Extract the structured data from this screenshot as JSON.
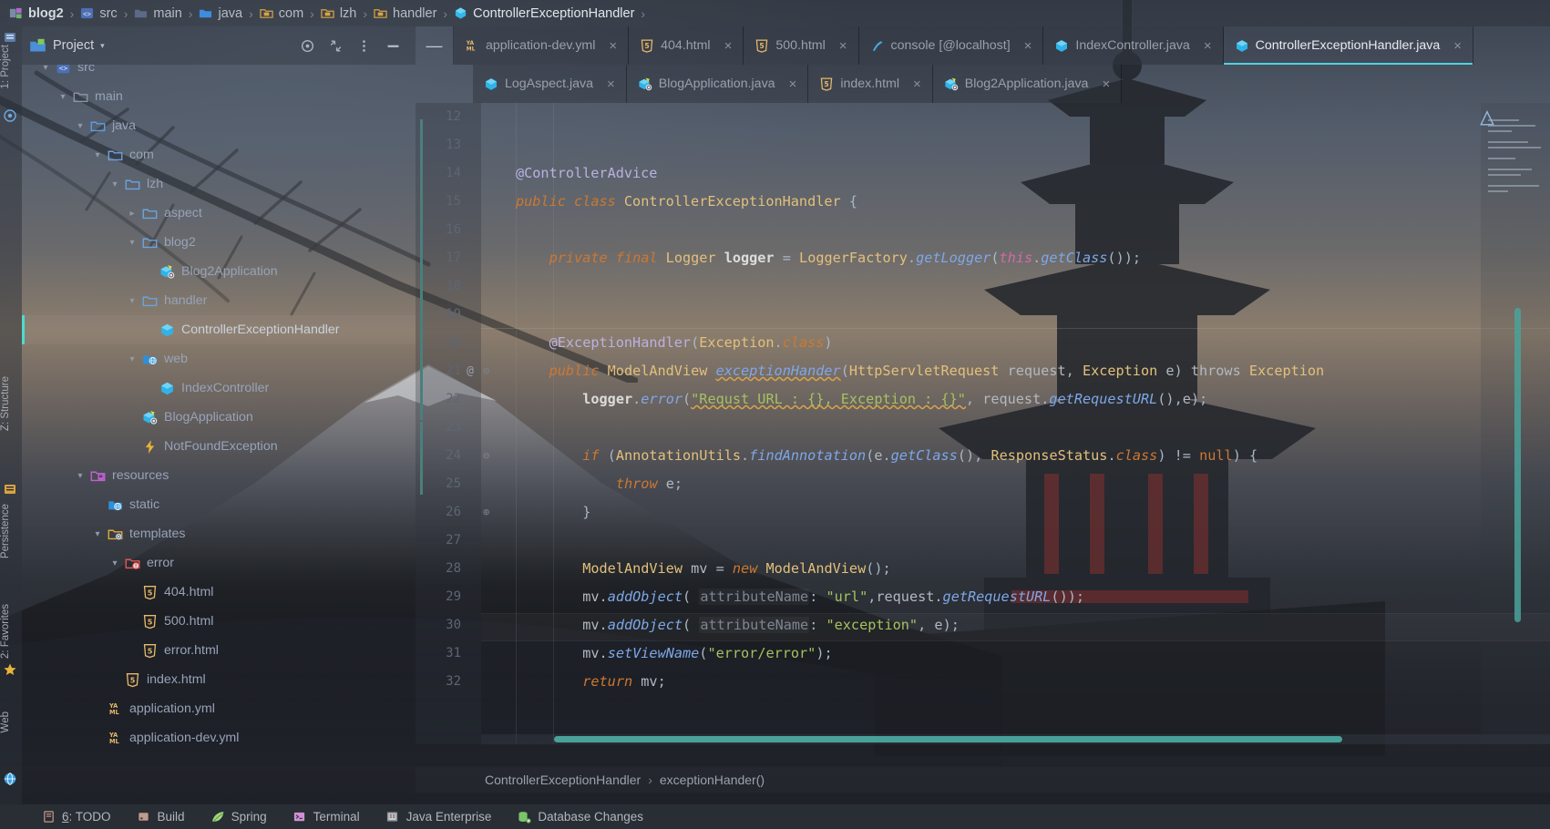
{
  "window": {
    "title": "ControllerExceptionHandler.java",
    "accent_color": "#4fd2e0",
    "background": "#2b2f36"
  },
  "breadcrumb": {
    "items": [
      {
        "label": "blog2",
        "icon": "module-icon"
      },
      {
        "label": "src",
        "icon": "source-root-icon"
      },
      {
        "label": "main",
        "icon": "folder-icon"
      },
      {
        "label": "java",
        "icon": "folder-blue-icon"
      },
      {
        "label": "com",
        "icon": "package-icon"
      },
      {
        "label": "lzh",
        "icon": "package-icon"
      },
      {
        "label": "handler",
        "icon": "package-icon"
      },
      {
        "label": "ControllerExceptionHandler",
        "icon": "java-class-icon"
      }
    ],
    "separator": "›"
  },
  "left_strip": {
    "tabs": [
      {
        "label": "1: Project",
        "icon": "project-icon"
      },
      {
        "label": "Z: Structure",
        "icon": "structure-icon"
      },
      {
        "label": "Persistence",
        "icon": "persistence-icon"
      },
      {
        "label": "2: Favorites",
        "icon": "star-icon"
      },
      {
        "label": "Web",
        "icon": "web-icon"
      }
    ]
  },
  "project_panel": {
    "title": "Project",
    "dropdown_caret": "▾",
    "actions": [
      {
        "name": "locate-icon",
        "glyph": "◎"
      },
      {
        "name": "collapse-all-icon",
        "glyph": "⇲"
      },
      {
        "name": "more-options-icon",
        "glyph": "⋮"
      },
      {
        "name": "hide-panel-icon",
        "glyph": "—"
      }
    ],
    "tree": [
      {
        "label": "src",
        "indent": 2,
        "arrow": "▾",
        "icon": "source-root-icon",
        "selected": false,
        "clipped": true
      },
      {
        "label": "main",
        "indent": 3,
        "arrow": "▾",
        "icon": "folder-grey-icon",
        "selected": false
      },
      {
        "label": "java",
        "indent": 4,
        "arrow": "▾",
        "icon": "folder-blue-icon",
        "selected": false
      },
      {
        "label": "com",
        "indent": 5,
        "arrow": "▾",
        "icon": "package-icon",
        "selected": false
      },
      {
        "label": "lzh",
        "indent": 6,
        "arrow": "▾",
        "icon": "package-icon",
        "selected": false
      },
      {
        "label": "aspect",
        "indent": 7,
        "arrow": "▸",
        "icon": "package-icon",
        "selected": false
      },
      {
        "label": "blog2",
        "indent": 7,
        "arrow": "▾",
        "icon": "package-icon",
        "selected": false
      },
      {
        "label": "Blog2Application",
        "indent": 8,
        "arrow": "",
        "icon": "spring-class-icon",
        "selected": false
      },
      {
        "label": "handler",
        "indent": 7,
        "arrow": "▾",
        "icon": "package-icon",
        "selected": false
      },
      {
        "label": "ControllerExceptionHandler",
        "indent": 8,
        "arrow": "",
        "icon": "java-class-icon",
        "selected": true
      },
      {
        "label": "web",
        "indent": 7,
        "arrow": "▾",
        "icon": "web-package-icon",
        "selected": false
      },
      {
        "label": "IndexController",
        "indent": 8,
        "arrow": "",
        "icon": "java-class-icon",
        "selected": false
      },
      {
        "label": "BlogApplication",
        "indent": 7,
        "arrow": "",
        "icon": "spring-class-icon",
        "selected": false
      },
      {
        "label": "NotFoundException",
        "indent": 7,
        "arrow": "",
        "icon": "exception-icon",
        "selected": false
      },
      {
        "label": "resources",
        "indent": 4,
        "arrow": "▾",
        "icon": "resources-root-icon",
        "selected": false
      },
      {
        "label": "static",
        "indent": 5,
        "arrow": "",
        "icon": "web-folder-icon",
        "selected": false
      },
      {
        "label": "templates",
        "indent": 5,
        "arrow": "▾",
        "icon": "templates-folder-icon",
        "selected": false
      },
      {
        "label": "error",
        "indent": 6,
        "arrow": "▾",
        "icon": "error-folder-icon",
        "selected": false
      },
      {
        "label": "404.html",
        "indent": 7,
        "arrow": "",
        "icon": "html5-icon",
        "selected": false
      },
      {
        "label": "500.html",
        "indent": 7,
        "arrow": "",
        "icon": "html5-icon",
        "selected": false
      },
      {
        "label": "error.html",
        "indent": 7,
        "arrow": "",
        "icon": "html5-icon",
        "selected": false
      },
      {
        "label": "index.html",
        "indent": 6,
        "arrow": "",
        "icon": "html5-icon",
        "selected": false
      },
      {
        "label": "application.yml",
        "indent": 5,
        "arrow": "",
        "icon": "yaml-icon",
        "selected": false
      },
      {
        "label": "application-dev.yml",
        "indent": 5,
        "arrow": "",
        "icon": "yaml-icon",
        "selected": false
      }
    ]
  },
  "editor_tabs": {
    "row1": [
      {
        "label": "application-dev.yml",
        "icon": "yaml-icon",
        "active": false,
        "closable": true
      },
      {
        "label": "404.html",
        "icon": "html5-icon",
        "active": false,
        "closable": true
      },
      {
        "label": "500.html",
        "icon": "html5-icon",
        "active": false,
        "closable": true
      },
      {
        "label": "console [@localhost]",
        "icon": "console-icon",
        "active": false,
        "closable": true
      },
      {
        "label": "IndexController.java",
        "icon": "java-class-icon",
        "active": false,
        "closable": true
      },
      {
        "label": "ControllerExceptionHandler.java",
        "icon": "java-class-icon",
        "active": true,
        "closable": true
      }
    ],
    "row2": [
      {
        "label": "LogAspect.java",
        "icon": "java-class-icon",
        "active": false,
        "closable": true
      },
      {
        "label": "BlogApplication.java",
        "icon": "spring-class-icon",
        "active": false,
        "closable": true
      },
      {
        "label": "index.html",
        "icon": "html5-icon",
        "active": false,
        "closable": true
      },
      {
        "label": "Blog2Application.java",
        "icon": "spring-class-icon",
        "active": false,
        "closable": true
      }
    ],
    "close_glyph": "×",
    "minimize_glyph": "—"
  },
  "code": {
    "file": "ControllerExceptionHandler.java",
    "first_visible_line": 12,
    "lines": [
      {
        "n": 12,
        "text": ""
      },
      {
        "n": 13,
        "text": ""
      },
      {
        "n": 14,
        "text": "@ControllerAdvice"
      },
      {
        "n": 15,
        "text": "public class ControllerExceptionHandler {"
      },
      {
        "n": 16,
        "text": ""
      },
      {
        "n": 17,
        "text": "    private final Logger logger = LoggerFactory.getLogger(this.getClass());"
      },
      {
        "n": 18,
        "text": ""
      },
      {
        "n": 19,
        "text": ""
      },
      {
        "n": 20,
        "text": "    @ExceptionHandler(Exception.class)"
      },
      {
        "n": 21,
        "text": "    public ModelAndView exceptionHander(HttpServletRequest request, Exception e) throws Exception"
      },
      {
        "n": 22,
        "text": "        logger.error(\"Requst URL : {}, Exception : {}\", request.getRequestURL(),e);"
      },
      {
        "n": 23,
        "text": ""
      },
      {
        "n": 24,
        "text": "        if (AnnotationUtils.findAnnotation(e.getClass(), ResponseStatus.class) != null) {"
      },
      {
        "n": 25,
        "text": "            throw e;"
      },
      {
        "n": 26,
        "text": "        }"
      },
      {
        "n": 27,
        "text": ""
      },
      {
        "n": 28,
        "text": "        ModelAndView mv = new ModelAndView();"
      },
      {
        "n": 29,
        "text": "        mv.addObject( attributeName: \"url\",request.getRequestURL());"
      },
      {
        "n": 30,
        "text": "        mv.addObject( attributeName: \"exception\", e);"
      },
      {
        "n": 31,
        "text": "        mv.setViewName(\"error/error\");"
      },
      {
        "n": 32,
        "text": "        return mv;"
      }
    ],
    "gutter_annotation_line": 21,
    "gutter_annotation_glyph": "@",
    "breadcrumb": {
      "class": "ControllerExceptionHandler",
      "method": "exceptionHander()",
      "separator": "›"
    }
  },
  "status_bar": {
    "items": [
      {
        "label": "6: TODO",
        "icon": "todo-icon",
        "mnemonic": "6"
      },
      {
        "label": "Build",
        "icon": "build-icon"
      },
      {
        "label": "Spring",
        "icon": "spring-leaf-icon"
      },
      {
        "label": "Terminal",
        "icon": "terminal-icon"
      },
      {
        "label": "Java Enterprise",
        "icon": "java-enterprise-icon"
      },
      {
        "label": "Database Changes",
        "icon": "database-changes-icon"
      }
    ]
  }
}
